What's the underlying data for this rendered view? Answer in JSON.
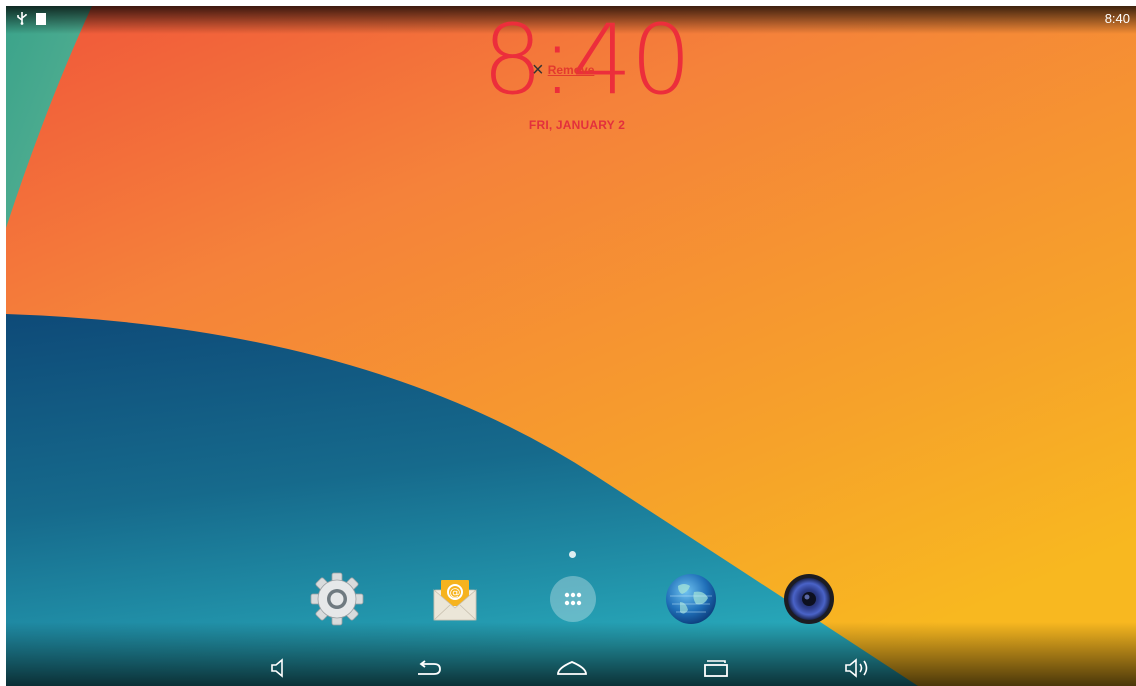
{
  "status_bar": {
    "time": "8:40",
    "icons": [
      "usb-icon",
      "sd-card-icon"
    ]
  },
  "widget": {
    "clock_time": "8:40",
    "date": "FRI, JANUARY 2",
    "remove_label": "Remove",
    "remove_icon": "close-icon"
  },
  "dock": {
    "apps": [
      {
        "name": "settings",
        "icon": "gear-icon"
      },
      {
        "name": "email",
        "icon": "email-icon"
      },
      {
        "name": "all-apps",
        "icon": "app-drawer-icon"
      },
      {
        "name": "browser",
        "icon": "globe-icon"
      },
      {
        "name": "music",
        "icon": "speaker-icon"
      }
    ]
  },
  "nav_bar": {
    "buttons": [
      "volume-down-icon",
      "back-icon",
      "home-icon",
      "recent-apps-icon",
      "volume-up-icon"
    ]
  },
  "colors": {
    "accent_red": "#ec2e3b",
    "wallpaper_orange": "#f5892f",
    "wallpaper_teal": "#1b85a0",
    "wallpaper_green": "#4aa889"
  }
}
